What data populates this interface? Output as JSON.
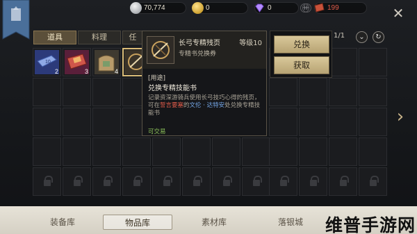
{
  "currencies": [
    {
      "icon": "silver-coin-icon",
      "value": "70,774"
    },
    {
      "icon": "gold-coin-icon",
      "value": "0"
    },
    {
      "icon": "diamond-icon",
      "value": "0"
    },
    {
      "icon": "ticket-icon",
      "value": "199"
    }
  ],
  "tabs": [
    "道具",
    "料理",
    "任"
  ],
  "pager": "1/1",
  "items": [
    {
      "icon": "tag-10-icon",
      "count": "2"
    },
    {
      "icon": "ticket-red-icon",
      "count": "3"
    },
    {
      "icon": "bag-icon",
      "count": "4"
    },
    {
      "icon": "bow-book-icon",
      "count": ""
    }
  ],
  "tooltip": {
    "name": "长弓专精残页",
    "level": "等级10",
    "sub": "专精书兑换券",
    "use_title": "[用途]",
    "use_name": "兑换专精技能书",
    "desc_1": "记录资深游骑兵使用长弓技巧心得的残页，可在",
    "desc_red": "誓言要塞",
    "desc_2": "的",
    "desc_blue": "文伦 · 达特安",
    "desc_3": "处兑换专精技能书",
    "trade": "可交易"
  },
  "actions": {
    "exchange": "兑换",
    "obtain": "获取"
  },
  "bottom_nav": [
    "装备库",
    "物品库",
    "素材库",
    "落银城"
  ],
  "watermark": "维普手游网",
  "colors": {
    "accent": "#d9bb76",
    "red": "#e05c4a",
    "blue": "#76a8e8",
    "green": "#8cc15a"
  }
}
